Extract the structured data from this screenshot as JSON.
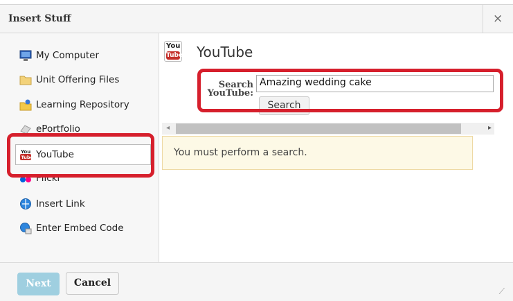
{
  "dialog": {
    "title": "Insert Stuff",
    "close_glyph": "×"
  },
  "sidebar": {
    "items": [
      {
        "label": "My Computer",
        "icon": "monitor-icon"
      },
      {
        "label": "Unit Offering Files",
        "icon": "folder-icon"
      },
      {
        "label": "Learning Repository",
        "icon": "repository-icon"
      },
      {
        "label": "ePortfolio",
        "icon": "eportfolio-icon"
      },
      {
        "label": "YouTube",
        "icon": "youtube-icon",
        "selected": true
      },
      {
        "label": "Flickr",
        "icon": "flickr-icon"
      },
      {
        "label": "Insert Link",
        "icon": "globe-link-icon"
      },
      {
        "label": "Enter Embed Code",
        "icon": "embed-code-icon"
      }
    ]
  },
  "main": {
    "title": "YouTube",
    "logo_top": "You",
    "logo_bottom": "Tube",
    "search_label_line1": "Search",
    "search_label_line2": "YouTube:",
    "search_value": "Amazing wedding cake",
    "search_button": "Search",
    "notice": "You must perform a search."
  },
  "footer": {
    "next_label": "Next",
    "cancel_label": "Cancel"
  },
  "colors": {
    "highlight_red": "#d61f2c",
    "next_button": "#9fcfe0",
    "notice_bg": "#fdf9e6"
  }
}
